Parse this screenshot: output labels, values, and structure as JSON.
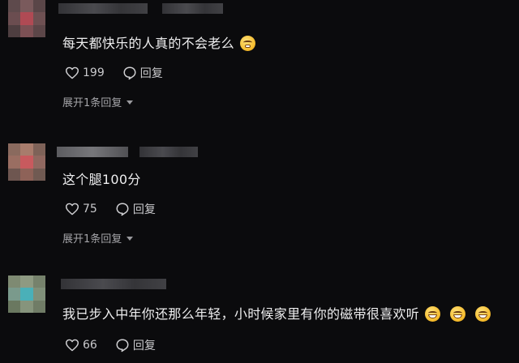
{
  "comments": [
    {
      "text": "每天都快乐的人真的不会老么",
      "emoji": "thinking-face-icon",
      "likes": "199",
      "reply_label": "回复",
      "expand_label": "展开1条回复"
    },
    {
      "text": "这个腿100分",
      "likes": "75",
      "reply_label": "回复",
      "expand_label": "展开1条回复"
    },
    {
      "text": "我已步入中年你还那么年轻，小时候家里有你的磁带很喜欢听",
      "emoji": "grinning-face-icon",
      "emoji_count": 3,
      "likes": "66",
      "reply_label": "回复"
    }
  ],
  "colors": {
    "background": "#0b0b0d",
    "text": "#eeeeef",
    "secondary_text": "#a4a4a8"
  }
}
